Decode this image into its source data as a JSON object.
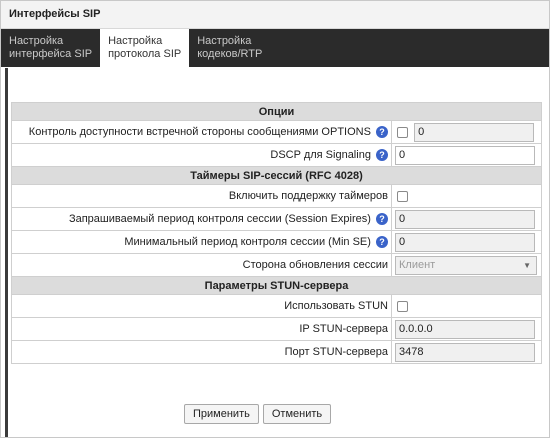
{
  "window": {
    "title": "Интерфейсы SIP"
  },
  "tabs": [
    {
      "line1": "Настройка",
      "line2": "интерфейса SIP",
      "active": false
    },
    {
      "line1": "Настройка",
      "line2": "протокола SIP",
      "active": true
    },
    {
      "line1": "Настройка",
      "line2": "кодеков/RTP",
      "active": false
    }
  ],
  "sections": {
    "options": "Опции",
    "timers": "Таймеры SIP-сессий (RFC 4028)",
    "stun": "Параметры STUN-сервера"
  },
  "rows": {
    "options_check": {
      "label": "Контроль доступности встречной стороны сообщениями OPTIONS",
      "value": "0",
      "checked": false
    },
    "dscp": {
      "label": "DSCP для Signaling",
      "value": "0"
    },
    "timers_enable": {
      "label": "Включить поддержку таймеров",
      "checked": false
    },
    "session_expires": {
      "label": "Запрашиваемый период контроля сессии (Session Expires)",
      "value": "0"
    },
    "min_se": {
      "label": "Минимальный период контроля сессии (Min SE)",
      "value": "0"
    },
    "refresher": {
      "label": "Сторона обновления сессии",
      "value": "Клиент"
    },
    "use_stun": {
      "label": "Использовать STUN",
      "checked": false
    },
    "stun_ip": {
      "label": "IP STUN-сервера",
      "value": "0.0.0.0"
    },
    "stun_port": {
      "label": "Порт STUN-сервера",
      "value": "3478"
    }
  },
  "icons": {
    "help": "help-icon",
    "dropdown": "chevron-down-icon"
  },
  "help_glyph": "?",
  "buttons": {
    "apply": "Применить",
    "cancel": "Отменить"
  }
}
